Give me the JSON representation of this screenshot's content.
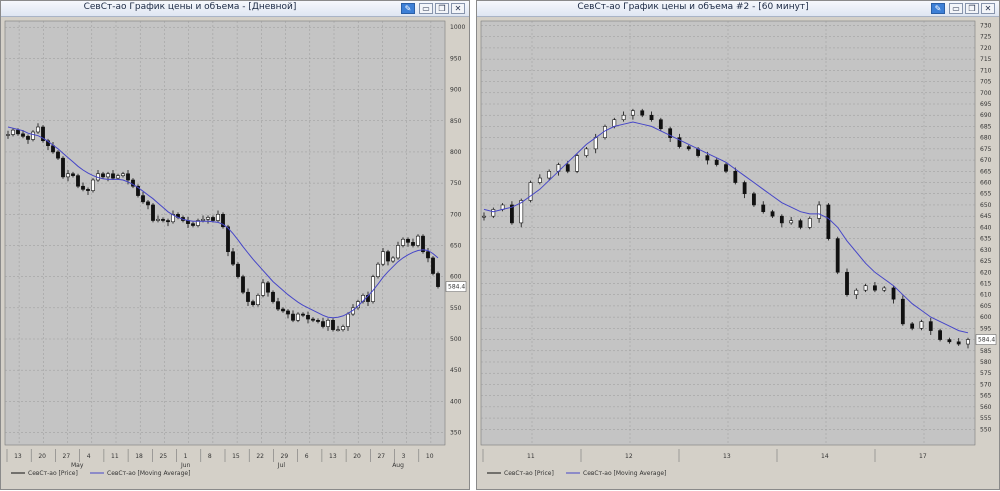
{
  "windows": [
    {
      "title": "СевСт-ао График цены и объема - [Дневной]",
      "last_price_label": "584.4",
      "legend": {
        "price": "СевСт-ао [Price]",
        "ma": "СевСт-ао [Moving Average]"
      },
      "x_top": [
        "13",
        "20",
        "27",
        "4",
        "11",
        "18",
        "25",
        "1",
        "8",
        "15",
        "22",
        "29",
        "6",
        "13",
        "20",
        "27",
        "3",
        "10"
      ],
      "x_months": [
        "May",
        "Jun",
        "Jul",
        "Aug"
      ]
    },
    {
      "title": "СевСт-ао График цены и объема #2 - [60 минут]",
      "last_price_label": "584.4",
      "legend": {
        "price": "СевСт-ао [Price]",
        "ma": "СевСт-ао [Moving Average]"
      },
      "x_top": [
        "11",
        "12",
        "13",
        "14",
        "17"
      ]
    }
  ],
  "colors": {
    "price": "#111111",
    "moving_average": "#4646c8",
    "panel": "#c4c4c4",
    "grid": "#9a9a9a"
  },
  "chart_data": [
    {
      "type": "line",
      "interval": "Дневной",
      "yticks": [
        350,
        400,
        450,
        500,
        550,
        600,
        650,
        700,
        750,
        800,
        850,
        900,
        950,
        1000
      ],
      "ylim": [
        330,
        1010
      ],
      "x_tick_labels": [
        "13",
        "20",
        "27",
        "4",
        "11",
        "18",
        "25",
        "1",
        "8",
        "15",
        "22",
        "29",
        "6",
        "13",
        "20",
        "27",
        "3",
        "10"
      ],
      "x_month_labels": [
        "May",
        "Jun",
        "Jul",
        "Aug"
      ],
      "series": [
        {
          "name": "СевСт-ао [Price]",
          "values": [
            828,
            835,
            829,
            825,
            820,
            832,
            840,
            818,
            810,
            800,
            790,
            760,
            765,
            762,
            745,
            740,
            738,
            755,
            765,
            760,
            765,
            758,
            762,
            765,
            755,
            745,
            730,
            720,
            715,
            690,
            692,
            690,
            688,
            700,
            695,
            690,
            685,
            682,
            690,
            692,
            695,
            690,
            700,
            680,
            640,
            620,
            600,
            575,
            560,
            555,
            570,
            590,
            575,
            560,
            548,
            545,
            540,
            530,
            540,
            538,
            532,
            530,
            528,
            520,
            530,
            515,
            515,
            520,
            540,
            550,
            560,
            570,
            560,
            600,
            620,
            640,
            625,
            630,
            650,
            660,
            655,
            650,
            665,
            640,
            630,
            605,
            584
          ]
        },
        {
          "name": "СевСт-ао [Moving Average]",
          "values": [
            840,
            838,
            836,
            834,
            830,
            828,
            826,
            822,
            817,
            811,
            805,
            798,
            791,
            784,
            777,
            771,
            766,
            762,
            759,
            757,
            756,
            756,
            756,
            755,
            752,
            748,
            743,
            737,
            731,
            725,
            718,
            711,
            704,
            699,
            695,
            692,
            690,
            689,
            689,
            689,
            689,
            688,
            687,
            684,
            678,
            669,
            659,
            648,
            638,
            628,
            619,
            610,
            601,
            592,
            585,
            578,
            571,
            565,
            559,
            554,
            550,
            546,
            542,
            538,
            535,
            534,
            535,
            537,
            541,
            546,
            553,
            561,
            569,
            578,
            588,
            599,
            608,
            616,
            624,
            630,
            635,
            639,
            642,
            643,
            642,
            637,
            630
          ]
        }
      ]
    },
    {
      "type": "line",
      "interval": "60 минут",
      "yticks": [
        550,
        555,
        560,
        565,
        570,
        575,
        580,
        585,
        590,
        595,
        600,
        605,
        610,
        615,
        620,
        625,
        630,
        635,
        640,
        645,
        650,
        655,
        660,
        665,
        670,
        675,
        680,
        685,
        690,
        695,
        700,
        705,
        710,
        715,
        720,
        725,
        730
      ],
      "ylim": [
        543,
        732
      ],
      "x_tick_labels": [
        "11",
        "12",
        "13",
        "14",
        "17"
      ],
      "series": [
        {
          "name": "СевСт-ао [Price]",
          "values": [
            645,
            648,
            650,
            642,
            652,
            660,
            662,
            665,
            668,
            665,
            672,
            675,
            680,
            685,
            688,
            690,
            692,
            690,
            688,
            684,
            680,
            676,
            675,
            672,
            670,
            668,
            665,
            660,
            655,
            650,
            647,
            645,
            642,
            643,
            640,
            644,
            650,
            635,
            620,
            610,
            612,
            614,
            612,
            613,
            608,
            597,
            595,
            598,
            594,
            590,
            589,
            588,
            590
          ]
        },
        {
          "name": "СевСт-ао [Moving Average]",
          "values": [
            648,
            647,
            648,
            649,
            651,
            654,
            657,
            661,
            665,
            669,
            673,
            677,
            680,
            683,
            685,
            686,
            687,
            686,
            685,
            683,
            681,
            679,
            677,
            675,
            673,
            671,
            669,
            666,
            663,
            660,
            657,
            654,
            651,
            649,
            647,
            646,
            646,
            644,
            640,
            634,
            629,
            624,
            620,
            617,
            614,
            610,
            606,
            603,
            600,
            598,
            596,
            594,
            593
          ]
        }
      ]
    }
  ]
}
